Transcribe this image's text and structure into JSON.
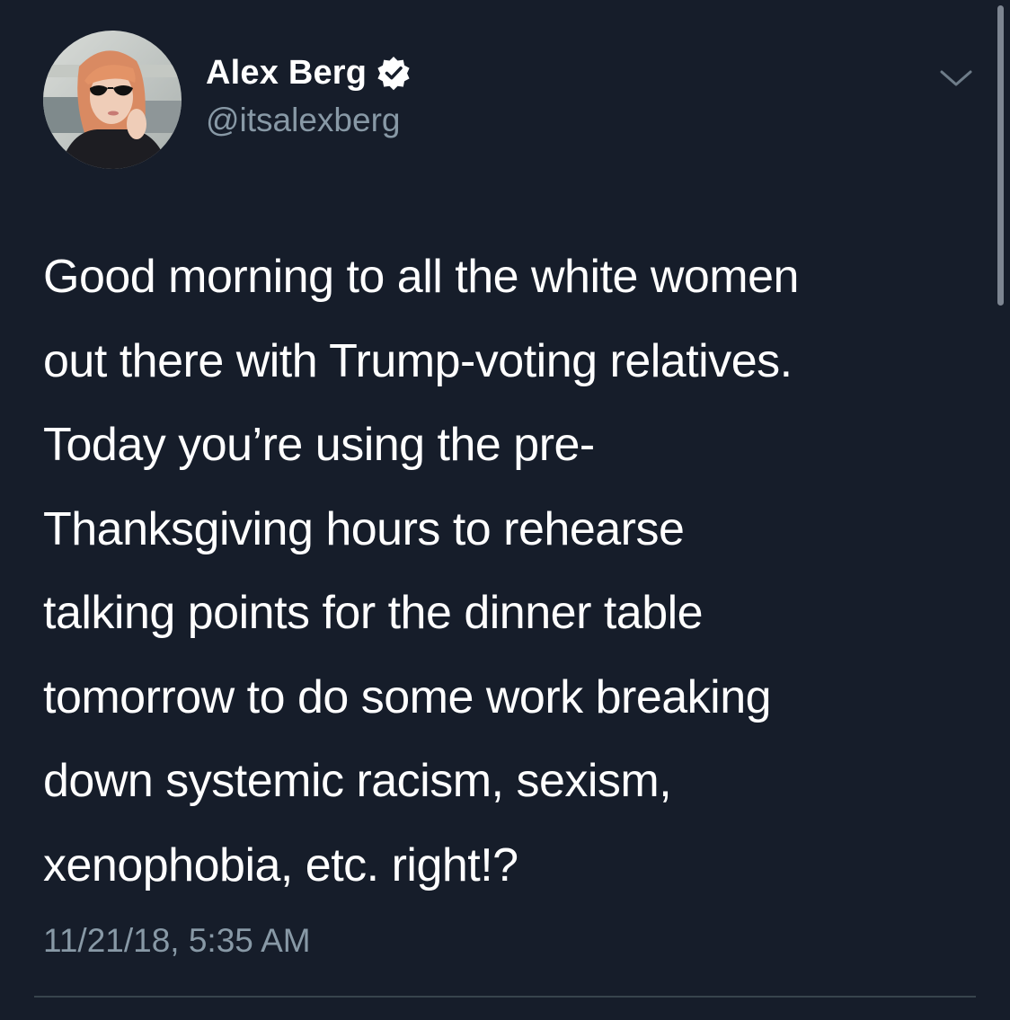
{
  "tweet": {
    "author": {
      "display_name": "Alex Berg",
      "handle": "@itsalexberg",
      "verified": true,
      "avatar_icon": "profile-photo"
    },
    "text_lines": [
      "Good morning to all the white women",
      "out there with Trump-voting relatives.",
      "Today you’re using the pre-",
      "Thanksgiving hours to rehearse",
      "talking points for the dinner table",
      "tomorrow to do some work breaking",
      "down systemic racism, sexism,",
      "xenophobia, etc. right!?"
    ],
    "timestamp": "11/21/18, 5:35 AM",
    "menu_icon": "chevron-down-icon"
  },
  "theme": {
    "background": "#161d2a",
    "text": "#ffffff",
    "secondary_text": "#8899a6",
    "verified_badge": "#ffffff",
    "divider": "#38444d"
  }
}
